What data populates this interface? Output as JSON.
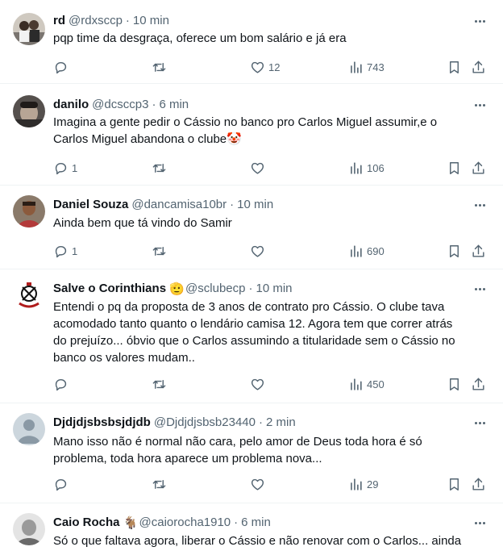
{
  "tweets": [
    {
      "name": "rd",
      "handle": "@rdxsccp",
      "time": "10 min",
      "text": "pqp time da desgraça, oferece um bom salário e já era",
      "replies": "",
      "retweets": "",
      "likes": "12",
      "views": "743"
    },
    {
      "name": "danilo",
      "handle": "@dcsccp3",
      "time": "6 min",
      "text": "Imagina a gente pedir o Cássio no banco pro Carlos Miguel assumir,e o\nCarlos Miguel abandona o clube🤡",
      "replies": "1",
      "retweets": "",
      "likes": "",
      "views": "106"
    },
    {
      "name": "Daniel Souza",
      "handle": "@dancamisa10br",
      "time": "10 min",
      "text": "Ainda bem que tá vindo do Samir",
      "replies": "1",
      "retweets": "",
      "likes": "",
      "views": "690"
    },
    {
      "name": "Salve o Corinthians",
      "badge": "🫡",
      "handle": "@sclubecp",
      "time": "10 min",
      "text": "Entendi o pq da proposta de 3 anos de contrato pro Cássio. O clube tava\nacomodado tanto quanto o lendário camisa 12. Agora tem que correr atrás\ndo prejuízo... óbvio que o Carlos assumindo a titularidade sem o Cássio no\nbanco os valores mudam..",
      "replies": "",
      "retweets": "",
      "likes": "",
      "views": "450"
    },
    {
      "name": "Djdjdjsbsbsjdjdb",
      "handle": "@Djdjdjsbsb23440",
      "time": "2 min",
      "text": "Mano isso não é normal não cara, pelo amor de Deus toda hora é só\nproblema, toda hora aparece um problema nova...",
      "replies": "",
      "retweets": "",
      "likes": "",
      "views": "29"
    },
    {
      "name": "Caio Rocha",
      "badge": "🐐",
      "handle": "@caiorocha1910",
      "time": "6 min",
      "text": "Só o que faltava agora, liberar o Cássio e não renovar com o Carlos... ainda",
      "replies": "",
      "retweets": "",
      "likes": "",
      "views": ""
    }
  ],
  "icons": {
    "reply": "reply-icon",
    "retweet": "retweet-icon",
    "like": "heart-icon",
    "views": "views-icon",
    "bookmark": "bookmark-icon",
    "share": "share-icon",
    "more": "more-icon"
  },
  "colors": {
    "text": "#0f1419",
    "secondary": "#536471",
    "divider": "#eff3f4"
  }
}
